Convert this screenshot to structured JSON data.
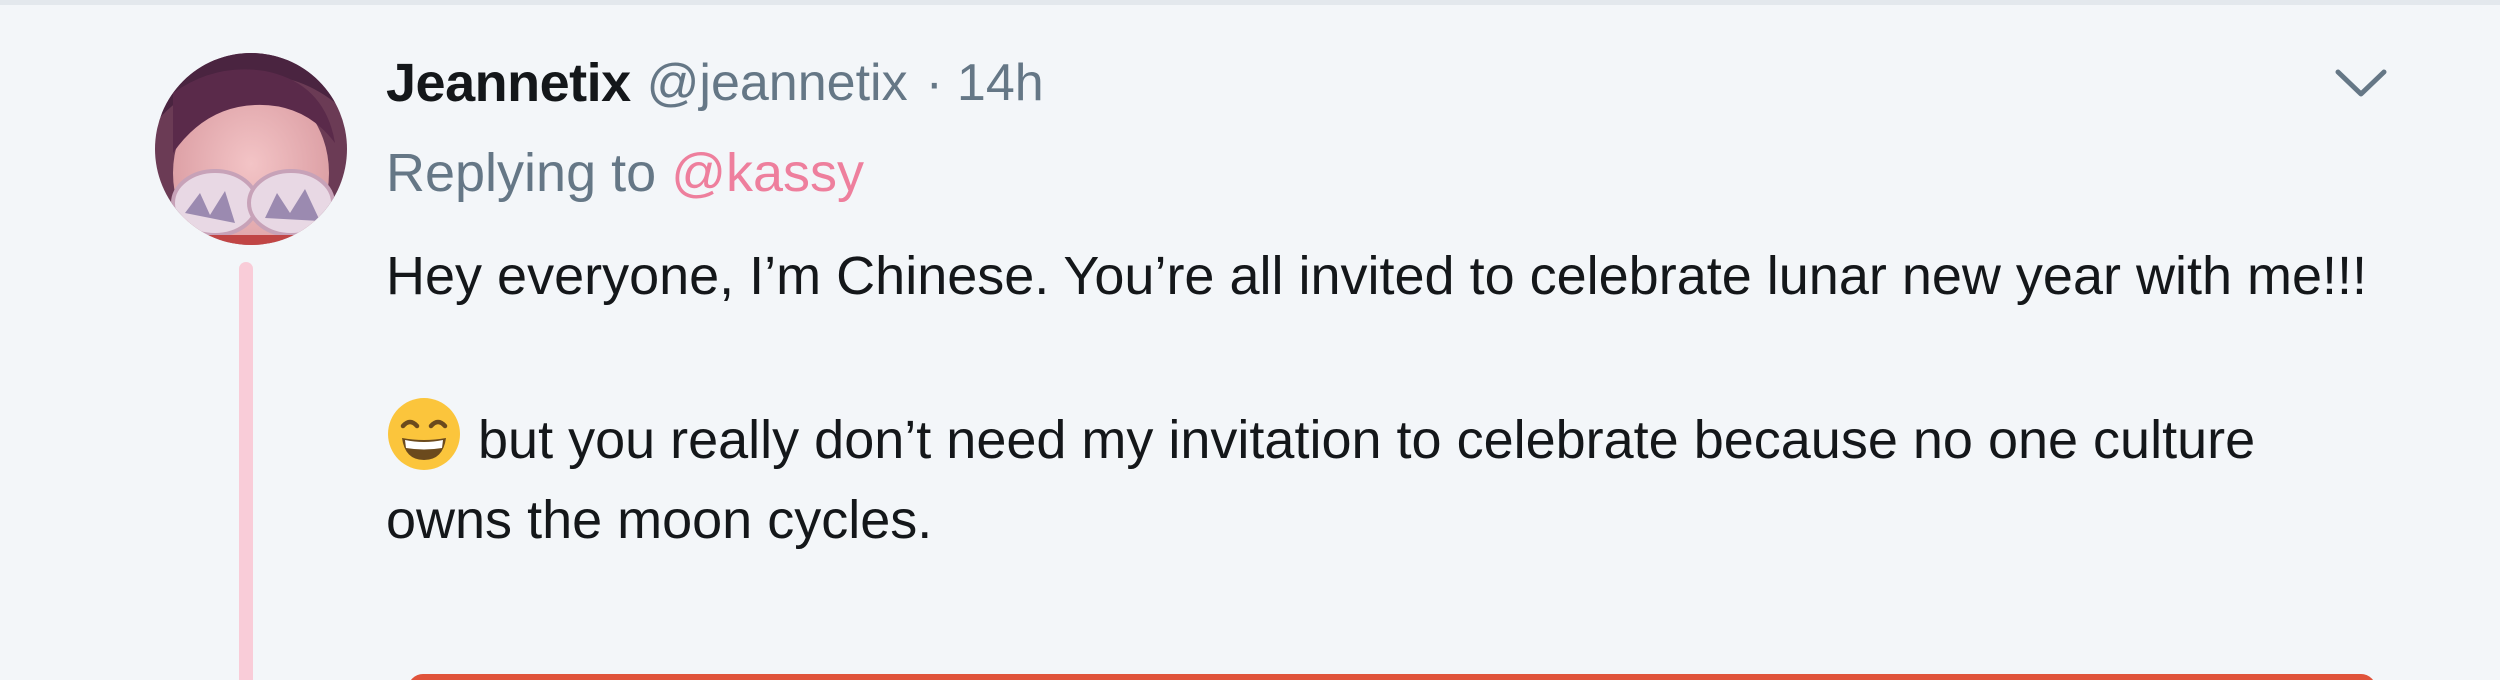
{
  "tweet": {
    "author_name": "Jeannetix",
    "author_handle": "@jeannetix",
    "separator": "·",
    "timestamp": "14h",
    "replying_prefix": "Replying to",
    "replying_to": "@kassy",
    "paragraph_1": "Hey everyone, I’m Chinese. You’re all invited to celebrate lunar new year with me!!!",
    "paragraph_2_emoji": "grinning-face-with-smiling-eyes",
    "paragraph_2": "but you really don’t need my invitation to celebrate because no one culture owns the moon cycles."
  },
  "icons": {
    "menu_caret": "chevron-down-icon",
    "avatar": "profile-photo"
  },
  "colors": {
    "background": "#f3f6f9",
    "mention": "#ee7f9d",
    "thread_line": "#f9ccd8",
    "secondary_text": "#657786",
    "primary_text": "#14171a",
    "card_accent": "#e0533b"
  }
}
